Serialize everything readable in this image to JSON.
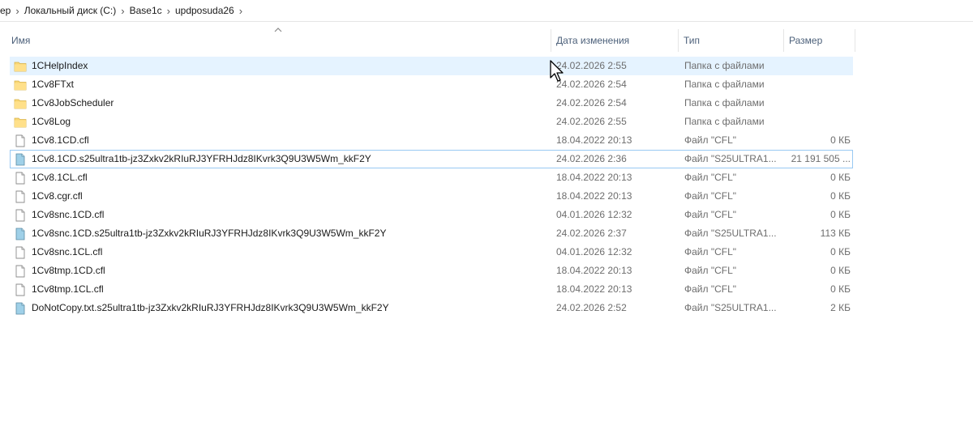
{
  "breadcrumb": [
    "ер",
    "Локальный диск (C:)",
    "Base1c",
    "updposuda26"
  ],
  "columns": {
    "name": "Имя",
    "date": "Дата изменения",
    "type": "Тип",
    "size": "Размер"
  },
  "rows": [
    {
      "name": "1CHelpIndex",
      "date": "24.02.2026 2:55",
      "type": "Папка с файлами",
      "size": "",
      "icon": "folder-icon",
      "state": "hover"
    },
    {
      "name": "1Cv8FTxt",
      "date": "24.02.2026 2:54",
      "type": "Папка с файлами",
      "size": "",
      "icon": "folder-icon"
    },
    {
      "name": "1Cv8JobScheduler",
      "date": "24.02.2026 2:54",
      "type": "Папка с файлами",
      "size": "",
      "icon": "folder-icon"
    },
    {
      "name": "1Cv8Log",
      "date": "24.02.2026 2:55",
      "type": "Папка с файлами",
      "size": "",
      "icon": "folder-icon"
    },
    {
      "name": "1Cv8.1CD.cfl",
      "date": "18.04.2022 20:13",
      "type": "Файл \"CFL\"",
      "size": "0 КБ",
      "icon": "file-icon"
    },
    {
      "name": "1Cv8.1CD.s25ultra1tb-jz3Zxkv2kRIuRJ3YFRHJdz8IKvrk3Q9U3W5Wm_kkF2Y",
      "date": "24.02.2026 2:36",
      "type": "Файл \"S25ULTRA1...",
      "size": "21 191 505 ...",
      "icon": "encrypted-file-icon",
      "state": "focused"
    },
    {
      "name": "1Cv8.1CL.cfl",
      "date": "18.04.2022 20:13",
      "type": "Файл \"CFL\"",
      "size": "0 КБ",
      "icon": "file-icon"
    },
    {
      "name": "1Cv8.cgr.cfl",
      "date": "18.04.2022 20:13",
      "type": "Файл \"CFL\"",
      "size": "0 КБ",
      "icon": "file-icon"
    },
    {
      "name": "1Cv8snc.1CD.cfl",
      "date": "04.01.2026 12:32",
      "type": "Файл \"CFL\"",
      "size": "0 КБ",
      "icon": "file-icon"
    },
    {
      "name": "1Cv8snc.1CD.s25ultra1tb-jz3Zxkv2kRIuRJ3YFRHJdz8IKvrk3Q9U3W5Wm_kkF2Y",
      "date": "24.02.2026 2:37",
      "type": "Файл \"S25ULTRA1...",
      "size": "113 КБ",
      "icon": "encrypted-file-icon"
    },
    {
      "name": "1Cv8snc.1CL.cfl",
      "date": "04.01.2026 12:32",
      "type": "Файл \"CFL\"",
      "size": "0 КБ",
      "icon": "file-icon"
    },
    {
      "name": "1Cv8tmp.1CD.cfl",
      "date": "18.04.2022 20:13",
      "type": "Файл \"CFL\"",
      "size": "0 КБ",
      "icon": "file-icon"
    },
    {
      "name": "1Cv8tmp.1CL.cfl",
      "date": "18.04.2022 20:13",
      "type": "Файл \"CFL\"",
      "size": "0 КБ",
      "icon": "file-icon"
    },
    {
      "name": "DoNotCopy.txt.s25ultra1tb-jz3Zxkv2kRIuRJ3YFRHJdz8IKvrk3Q9U3W5Wm_kkF2Y",
      "date": "24.02.2026 2:52",
      "type": "Файл \"S25ULTRA1...",
      "size": "2 КБ",
      "icon": "encrypted-file-icon"
    }
  ],
  "colors": {
    "hover_bg": "#e5f3ff",
    "focus_border": "#99c9f3",
    "header_text": "#4c607a",
    "folder": "#f8d775"
  }
}
